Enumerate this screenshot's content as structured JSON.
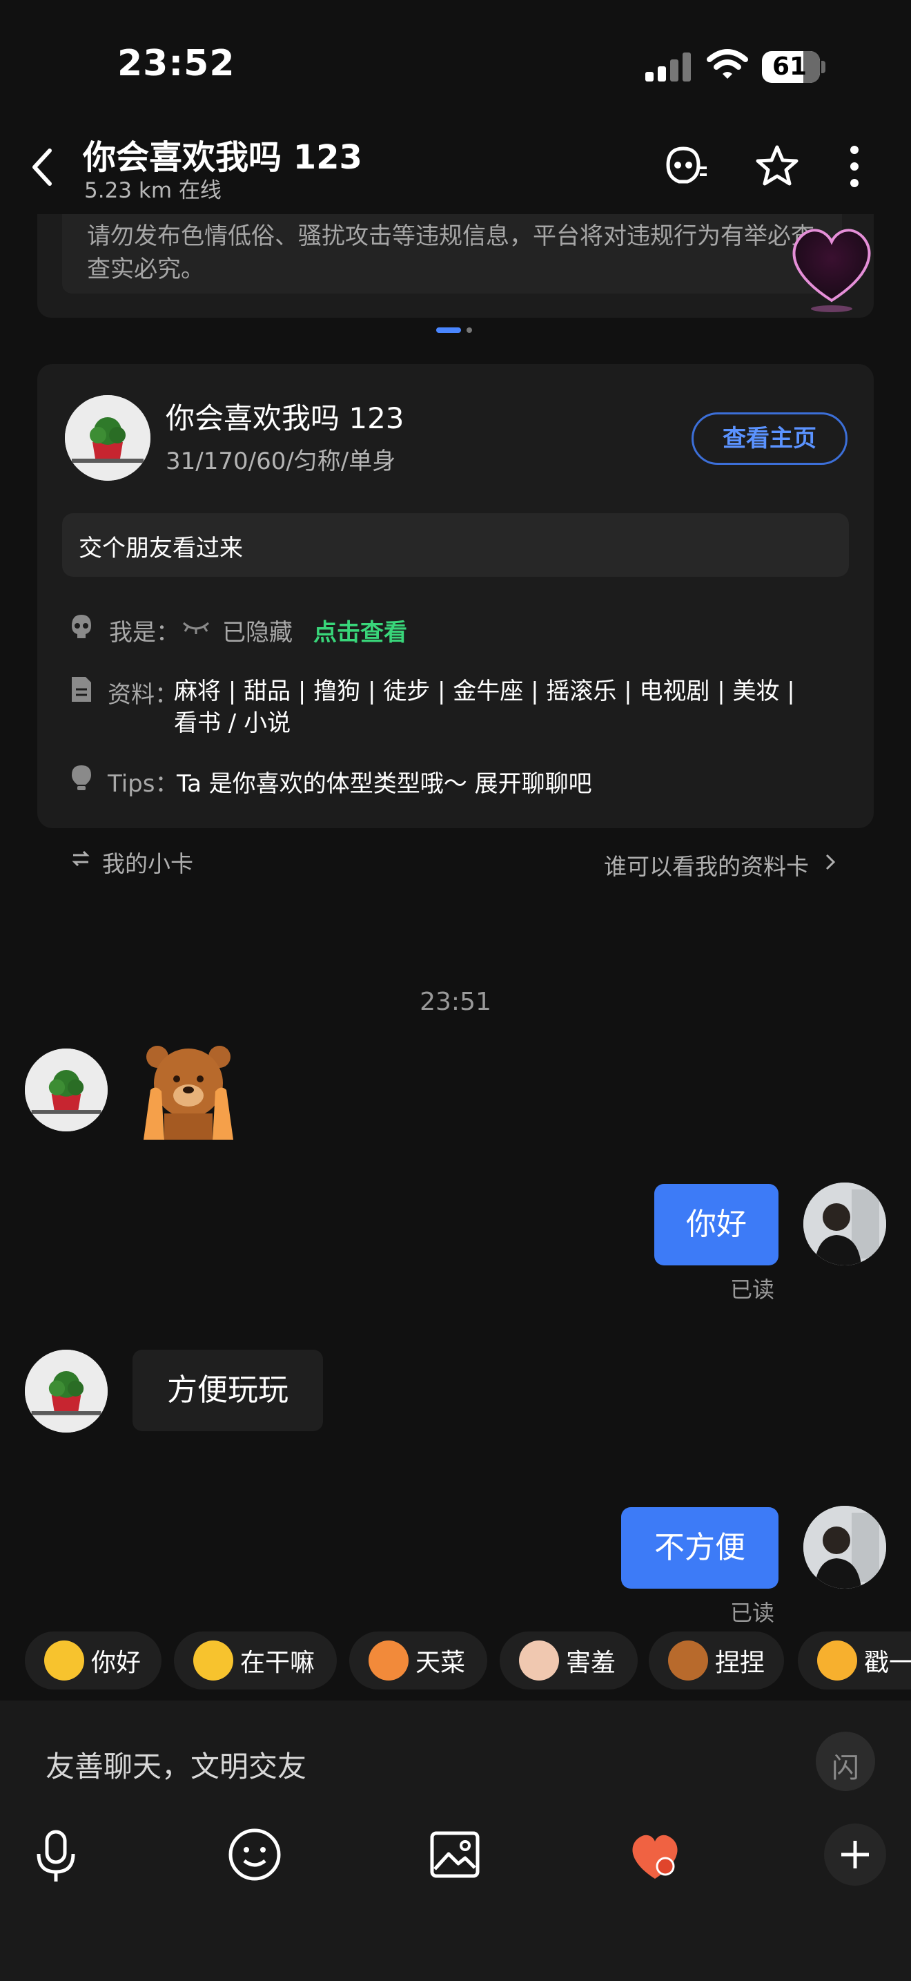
{
  "status_bar": {
    "time": "23:52",
    "battery": "61",
    "icons": [
      "signal-icon",
      "wifi-icon",
      "battery-icon"
    ]
  },
  "header": {
    "title": "你会喜欢我吗 123",
    "subtitle": "5.23 km  在线",
    "icons": [
      "back-icon",
      "mask-icon",
      "star-icon",
      "more-icon"
    ]
  },
  "notice": {
    "text": "请勿发布色情低俗、骚扰攻击等违规信息，平台将对违规行为有举必查、查实必究。"
  },
  "profile_card": {
    "name": "你会喜欢我吗 123",
    "stats": "31/170/60/匀称/单身",
    "view_button": "查看主页",
    "intro": "交个朋友看过来",
    "identity_label": "我是：",
    "identity_value": "已隐藏",
    "identity_link": "点击查看",
    "tags_label": "资料：",
    "tags_value": "麻将 | 甜品 | 撸狗 | 徒步 | 金牛座 | 摇滚乐 | 电视剧 | 美妆 | 看书 / 小说",
    "tips_label": "Tips：",
    "tips_value": "Ta 是你喜欢的体型类型哦～ 展开聊聊吧"
  },
  "card_footer": {
    "my_card": "我的小卡",
    "who_can_see": "谁可以看我的资料卡"
  },
  "chat": {
    "timestamp": "23:51",
    "messages": [
      {
        "from": "them",
        "type": "sticker",
        "sticker": "bear-sticker"
      },
      {
        "from": "me",
        "text": "你好",
        "status": "已读"
      },
      {
        "from": "them",
        "text": "方便玩玩"
      },
      {
        "from": "me",
        "text": "不方便",
        "status": "已读"
      }
    ]
  },
  "quick_replies": [
    "你好",
    "在干嘛",
    "天菜",
    "害羞",
    "捏捏",
    "戳一"
  ],
  "input": {
    "placeholder": "友善聊天，文明交友",
    "flash_label": "闪"
  },
  "toolbar": [
    "mic-icon",
    "emoji-icon",
    "image-icon",
    "heart-gift-icon",
    "plus-icon"
  ],
  "colors": {
    "accent": "#3d7bf7",
    "link_green": "#39d67a",
    "background": "#111111",
    "card": "#1c1c1c"
  }
}
